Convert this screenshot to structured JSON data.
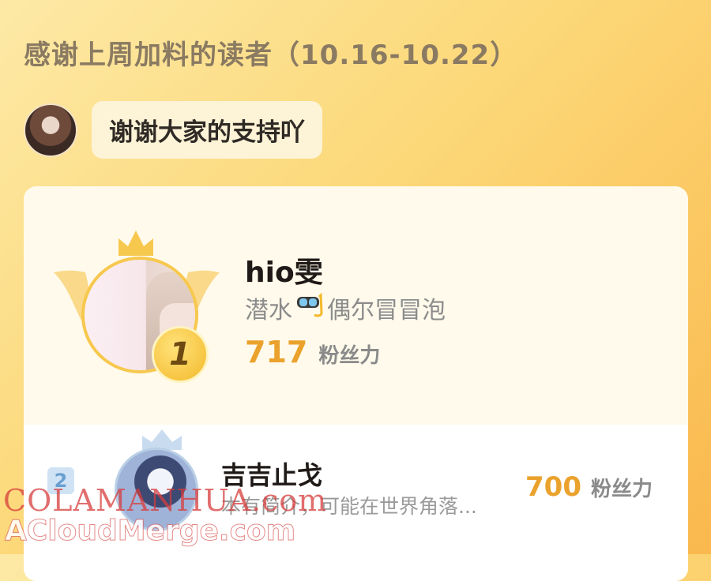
{
  "header": {
    "title": "感谢上周加料的读者（10.16-10.22）"
  },
  "message": {
    "text": "谢谢大家的支持吖"
  },
  "leaderboard": {
    "first": {
      "rank": "1",
      "name": "hio雯",
      "status_before": "潜水",
      "status_after": "偶尔冒冒泡",
      "status_icon": "diving-goggles-icon",
      "score": "717",
      "unit": "粉丝力"
    },
    "second": {
      "rank": "2",
      "name": "吉吉止戈",
      "desc": "本有简介，可能在世界角落...",
      "score": "700",
      "unit": "粉丝力"
    }
  },
  "watermarks": {
    "line1": "COLAMANHUA.com",
    "line2": "ACloudMerge.com"
  },
  "colors": {
    "accent": "#eaa22c",
    "gold": "#f7c84e",
    "background": "#fcd878"
  }
}
